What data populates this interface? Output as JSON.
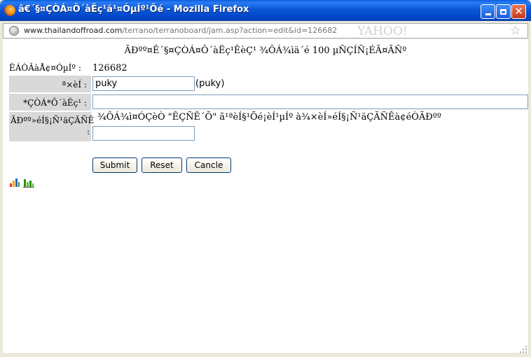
{
  "window": {
    "title": "â€´§¤ÇÒÁ¤Ô´àËç¹ã¹¤ÓµÍº¹Õé - Mozilla Firefox",
    "minimize_icon": "minimize-icon",
    "maximize_icon": "maximize-icon",
    "close_icon": "close-icon"
  },
  "urlbar": {
    "host": "www.thailandoffroad.com",
    "path": "/terrano/terranoboard/jam.asp?action=edit&id=126682",
    "yahoo_mark": "YAHOO!"
  },
  "page": {
    "heading": "ÃÐºº¤Ê´§¤ÇÒÁ¤Ô´àËç¹ÊèÇ¹ ¾ÔÁ¾ìä´é 100 µÑÇÍÑ¡ÉÃ¤ÃÑº",
    "id_label": "ËÁÒÂàÅ¢¤ÓµÍº :",
    "id_value": "126682",
    "name_label": "ª×èÍ :",
    "name_value": "puky",
    "name_echo": "(puky)",
    "title_label": "*ÇÒÁ*Ô´àËç¹ :",
    "title_value": "",
    "message_label": "ÃÐºº»éÍ§¡Ñ¹äÇÃÑÊ :",
    "message_text": "¾ÔÁ¾ì¤ÓÇèÒ \"ÊÇÑÊ´Õ\" ã¹ªèÍ§¹Õé¡èÍ¹µÍº à¾×èÍ»éÍ§¡Ñ¹äÇÃÑÊà¢éÒÃÐºº",
    "message_value": "",
    "buttons": {
      "submit": "Submit",
      "reset": "Reset",
      "cancle": "Cancle"
    },
    "icons": [
      "bar-stats-icon",
      "green-stats-icon"
    ]
  },
  "colors": {
    "titlebar": "#0054e3",
    "label_bg": "#d9d9d9",
    "window_bg": "#ece9d8"
  }
}
